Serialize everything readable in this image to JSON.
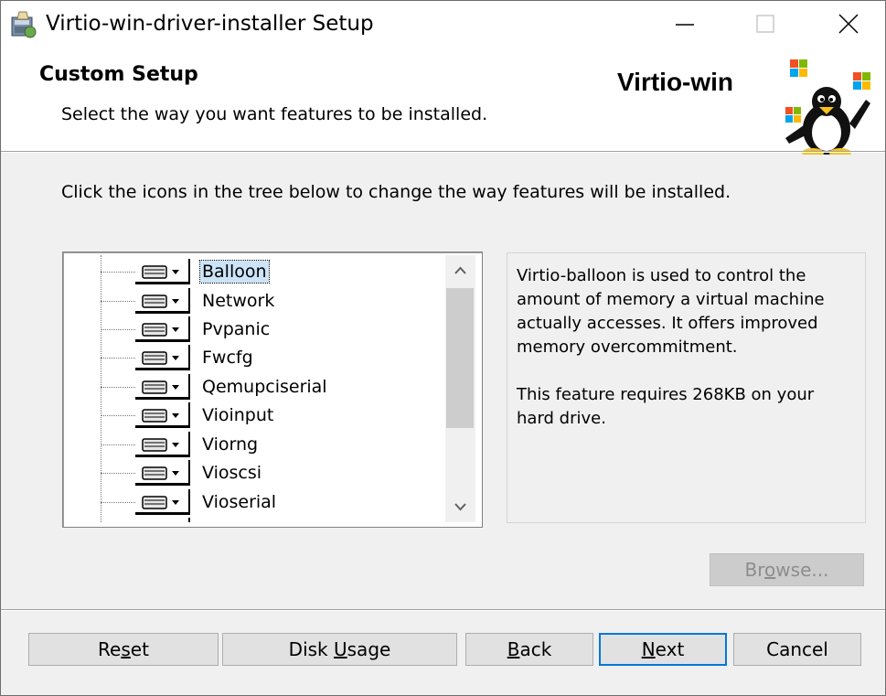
{
  "window": {
    "title": "Virtio-win-driver-installer Setup",
    "controls": {
      "minimize": "—",
      "maximize": "☐",
      "close": "✕"
    }
  },
  "header": {
    "title": "Custom Setup",
    "subtitle": "Select the way you want features to be installed.",
    "brand": "Virtio-win"
  },
  "instruction": "Click the icons in the tree below to change the way features will be installed.",
  "tree": {
    "items": [
      {
        "label": "Balloon",
        "selected": true
      },
      {
        "label": "Network"
      },
      {
        "label": "Pvpanic"
      },
      {
        "label": "Fwcfg"
      },
      {
        "label": "Qemupciserial"
      },
      {
        "label": "Vioinput"
      },
      {
        "label": "Viorng"
      },
      {
        "label": "Vioscsi"
      },
      {
        "label": "Vioserial"
      }
    ]
  },
  "description": {
    "text": "Virtio-balloon is used to control the amount of memory a virtual machine actually accesses. It offers improved memory overcommitment.\n\nThis feature requires 268KB on your hard drive."
  },
  "buttons": {
    "browse": {
      "pre": "Br",
      "key": "o",
      "post": "wse...",
      "enabled": false
    },
    "reset": {
      "pre": "Re",
      "key": "s",
      "post": "et"
    },
    "disk_usage": {
      "pre": "Disk ",
      "key": "U",
      "post": "sage"
    },
    "back": {
      "pre": "",
      "key": "B",
      "post": "ack"
    },
    "next": {
      "pre": "",
      "key": "N",
      "post": "ext"
    },
    "cancel": {
      "label": "Cancel"
    }
  },
  "colors": {
    "selection": "#cce4f7",
    "focus_border": "#0078d7",
    "window_bg": "#f0f0f0"
  }
}
